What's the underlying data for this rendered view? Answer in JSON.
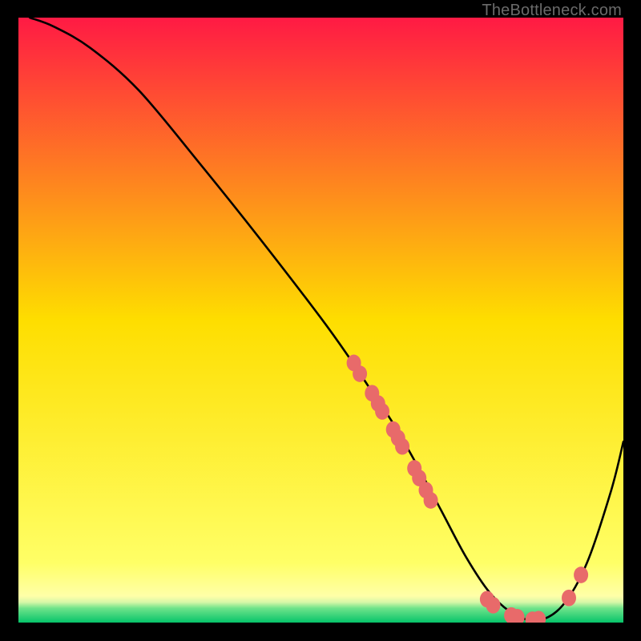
{
  "watermark": "TheBottleneck.com",
  "chart_data": {
    "type": "line",
    "title": "",
    "xlabel": "",
    "ylabel": "",
    "xlim": [
      0,
      100
    ],
    "ylim": [
      0,
      100
    ],
    "background_gradient": {
      "stops": [
        {
          "offset": 0.0,
          "color": "#ff1a44"
        },
        {
          "offset": 0.5,
          "color": "#fede00"
        },
        {
          "offset": 0.9,
          "color": "#ffff66"
        },
        {
          "offset": 0.955,
          "color": "#ffffa8"
        },
        {
          "offset": 0.965,
          "color": "#d8f7a8"
        },
        {
          "offset": 0.975,
          "color": "#6fe38a"
        },
        {
          "offset": 1.0,
          "color": "#00c268"
        }
      ]
    },
    "series": [
      {
        "name": "bottleneck-curve",
        "x": [
          2,
          6,
          12,
          20,
          30,
          40,
          50,
          55,
          58,
          62,
          66,
          70,
          74,
          78,
          82,
          86,
          90,
          94,
          98,
          100
        ],
        "y": [
          100,
          98.5,
          95,
          88,
          76,
          63.5,
          50.5,
          43.5,
          39,
          33,
          26,
          18.5,
          11,
          5,
          1.5,
          0.5,
          3,
          10,
          22,
          30
        ]
      }
    ],
    "scatter_points": {
      "name": "highlighted-points",
      "color": "#e86a6a",
      "radius": 9,
      "points": [
        {
          "x": 55.5,
          "y": 43.0
        },
        {
          "x": 56.5,
          "y": 41.2
        },
        {
          "x": 58.5,
          "y": 38.0
        },
        {
          "x": 59.5,
          "y": 36.3
        },
        {
          "x": 60.2,
          "y": 35.0
        },
        {
          "x": 62.0,
          "y": 32.0
        },
        {
          "x": 62.8,
          "y": 30.6
        },
        {
          "x": 63.5,
          "y": 29.2
        },
        {
          "x": 65.5,
          "y": 25.6
        },
        {
          "x": 66.3,
          "y": 24.0
        },
        {
          "x": 67.4,
          "y": 22.0
        },
        {
          "x": 68.2,
          "y": 20.3
        },
        {
          "x": 77.5,
          "y": 4.0
        },
        {
          "x": 78.5,
          "y": 3.0
        },
        {
          "x": 81.5,
          "y": 1.3
        },
        {
          "x": 82.5,
          "y": 1.0
        },
        {
          "x": 85.0,
          "y": 0.6
        },
        {
          "x": 86.0,
          "y": 0.7
        },
        {
          "x": 91.0,
          "y": 4.2
        },
        {
          "x": 93.0,
          "y": 8.0
        }
      ]
    }
  }
}
